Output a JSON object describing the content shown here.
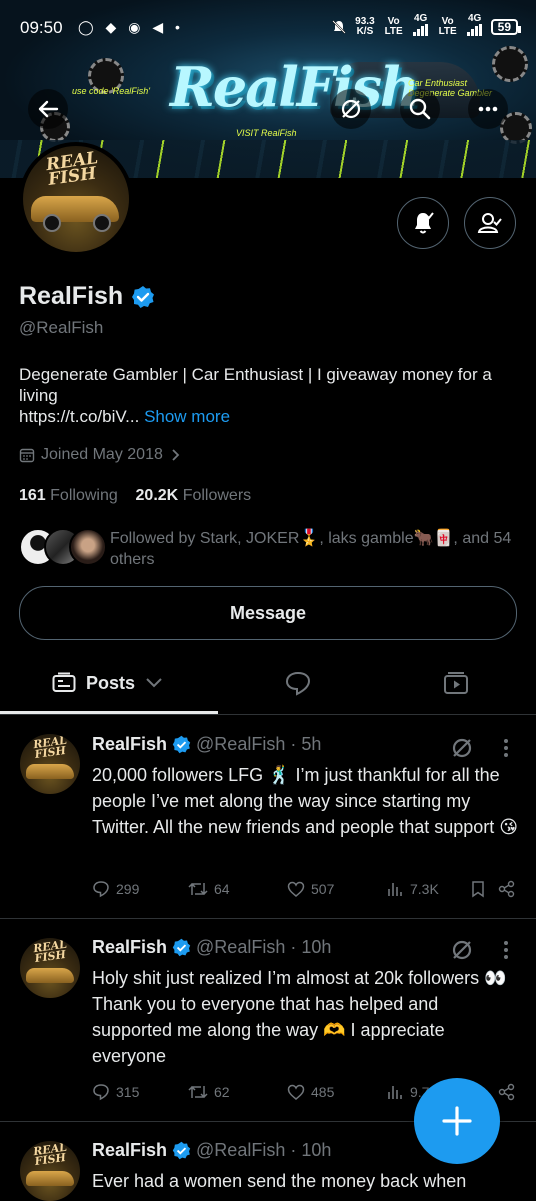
{
  "status_bar": {
    "time": "09:50",
    "notif_icons": "◯ ◆ ◉ ◀ •",
    "speed_value": "93.3",
    "speed_unit": "K/S",
    "net1": "Vo LTE",
    "net1_gen": "4G",
    "net2": "Vo LTE",
    "net2_gen": "4G",
    "battery": "59"
  },
  "banner": {
    "title": "RealFish",
    "small_left": "use code 'RealFish'",
    "small_bottom": "VISIT RealFish",
    "small_right": "Car Enthusiast Degenerate Gambler"
  },
  "profile": {
    "avatar_logo": "REAL FISH",
    "name": "RealFish",
    "handle": "@RealFish",
    "bio_text": "Degenerate Gambler | Car Enthusiast | I giveaway money for a living",
    "bio_link": "https://t.co/biV...",
    "show_more": "Show more",
    "joined": "Joined May 2018",
    "following_count": "161",
    "following_label": "Following",
    "followers_count": "20.2K",
    "followers_label": "Followers",
    "followed_by": "Followed by Stark, JOKER🎖️, laks gamble🐂🀄, and 54 others",
    "message_button": "Message"
  },
  "tabs": {
    "posts": "Posts"
  },
  "tweets": [
    {
      "name": "RealFish",
      "handle": "@RealFish",
      "dot": "·",
      "time": "5h",
      "text": "20,000 followers LFG 🕺 I’m just thankful for all the people I’ve met along the way since starting my Twitter. All the new friends and people that support 😘",
      "replies": "299",
      "retweets": "64",
      "likes": "507",
      "views": "7.3K"
    },
    {
      "name": "RealFish",
      "handle": "@RealFish",
      "dot": "·",
      "time": "10h",
      "text": "Holy shit just realized I’m almost at 20k followers 👀 Thank you to everyone that has helped and supported me along the way 🫶 I appreciate everyone",
      "replies": "315",
      "retweets": "62",
      "likes": "485",
      "views": "9.7"
    },
    {
      "name": "RealFish",
      "handle": "@RealFish",
      "dot": "·",
      "time": "10h",
      "text": "Ever had a women send the money back when"
    }
  ],
  "colors": {
    "accent": "#1d9bf0",
    "background": "#000000",
    "text": "#e7e9ea",
    "muted": "#71767b",
    "border": "#2f3336"
  },
  "icons": [
    "back-arrow-icon",
    "grok-icon",
    "search-icon",
    "more-icon",
    "bell-icon",
    "user-check-icon",
    "verified-icon",
    "calendar-icon",
    "chevron-right-icon",
    "posts-icon",
    "chevron-down-icon",
    "reply-bubble-icon",
    "video-icon",
    "reply-icon",
    "retweet-icon",
    "like-icon",
    "views-icon",
    "bookmark-icon",
    "share-icon",
    "plus-icon"
  ]
}
